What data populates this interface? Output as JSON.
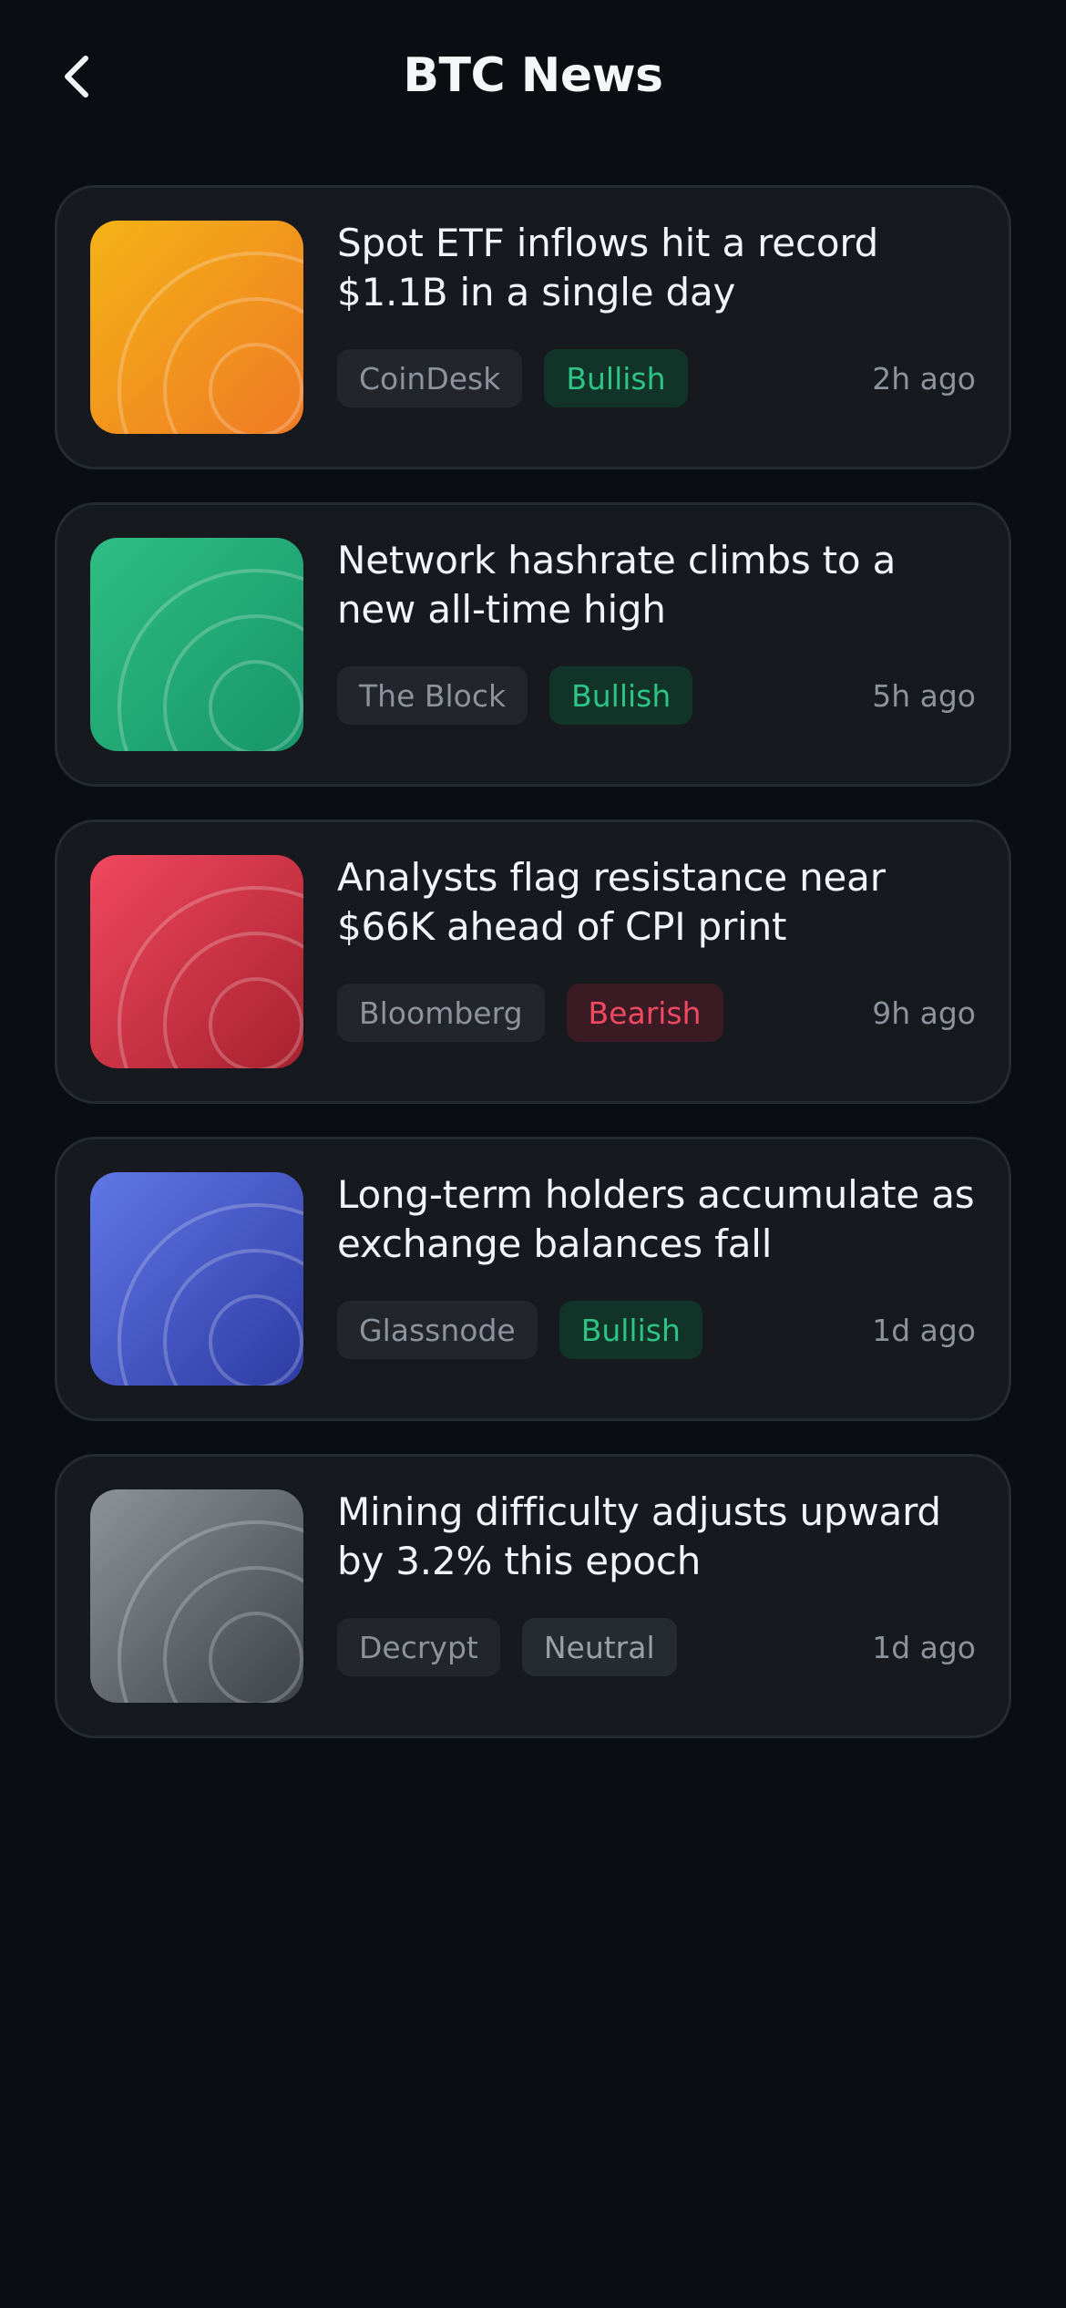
{
  "header": {
    "title": "BTC News",
    "back_icon": "chevron-left-icon"
  },
  "news": [
    {
      "title": "Spot ETF inflows hit a record $1.1B in a single day",
      "source": "CoinDesk",
      "sentiment": "Bullish",
      "sentiment_kind": "bullish",
      "time": "2h ago",
      "thumb_colors": [
        "#f4b316",
        "#ef7a24"
      ]
    },
    {
      "title": "Network hashrate climbs to a new all-time high",
      "source": "The Block",
      "sentiment": "Bullish",
      "sentiment_kind": "bullish",
      "time": "5h ago",
      "thumb_colors": [
        "#2fbd84",
        "#17966a"
      ]
    },
    {
      "title": "Analysts flag resistance near $66K ahead of CPI print",
      "source": "Bloomberg",
      "sentiment": "Bearish",
      "sentiment_kind": "bearish",
      "time": "9h ago",
      "thumb_colors": [
        "#f0485e",
        "#a8212f"
      ]
    },
    {
      "title": "Long-term holders accumulate as exchange balances fall",
      "source": "Glassnode",
      "sentiment": "Bullish",
      "sentiment_kind": "bullish",
      "time": "1d ago",
      "thumb_colors": [
        "#6077e6",
        "#2e3ba4"
      ]
    },
    {
      "title": "Mining difficulty adjusts upward by 3.2% this epoch",
      "source": "Decrypt",
      "sentiment": "Neutral",
      "sentiment_kind": "neutral",
      "time": "1d ago",
      "thumb_colors": [
        "#8d9399",
        "#3e4349"
      ]
    }
  ],
  "colors": {
    "background": "#0a0d11",
    "card": "#16191e",
    "card_border": "#262a31",
    "bullish": "#2ec486",
    "bearish": "#f04a63"
  }
}
